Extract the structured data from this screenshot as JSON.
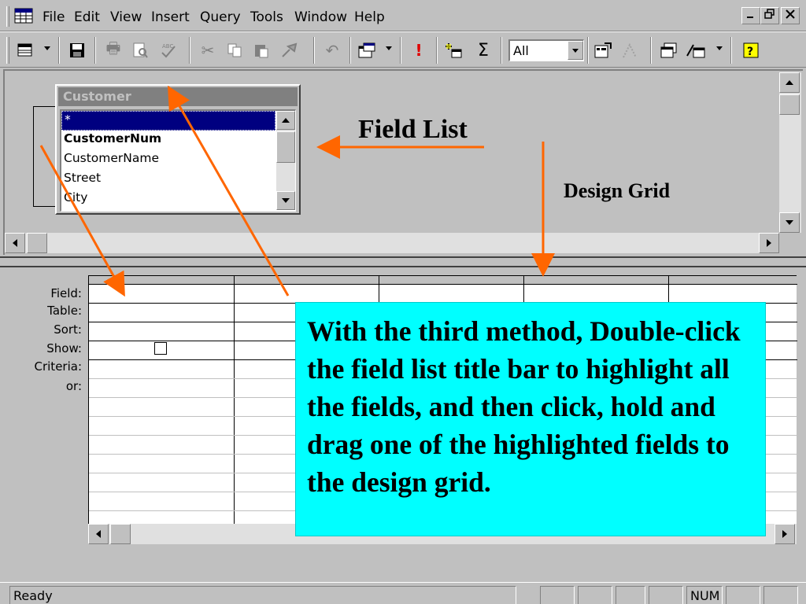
{
  "menu": {
    "file": "File",
    "edit": "Edit",
    "view": "View",
    "insert": "Insert",
    "query": "Query",
    "tools": "Tools",
    "window": "Window",
    "help": "Help"
  },
  "toolbar": {
    "top_values_combo": "All"
  },
  "field_list": {
    "title": "Customer",
    "items": [
      "*",
      "CustomerNum",
      "CustomerName",
      "Street",
      "City"
    ]
  },
  "grid": {
    "row_labels": [
      "Field:",
      "Table:",
      "Sort:",
      "Show:",
      "Criteria:",
      "or:"
    ]
  },
  "status": {
    "text": "Ready",
    "num": "NUM"
  },
  "annotations": {
    "field_list_label": "Field List",
    "design_grid_label": "Design Grid",
    "callout": "With the third method, Double-click the field list title bar to highlight all the fields, and then click, hold and drag one of the highlighted fields to the design grid."
  },
  "colors": {
    "callout_bg": "#00ffff",
    "arrow": "#ff6600",
    "selection": "#000080"
  }
}
